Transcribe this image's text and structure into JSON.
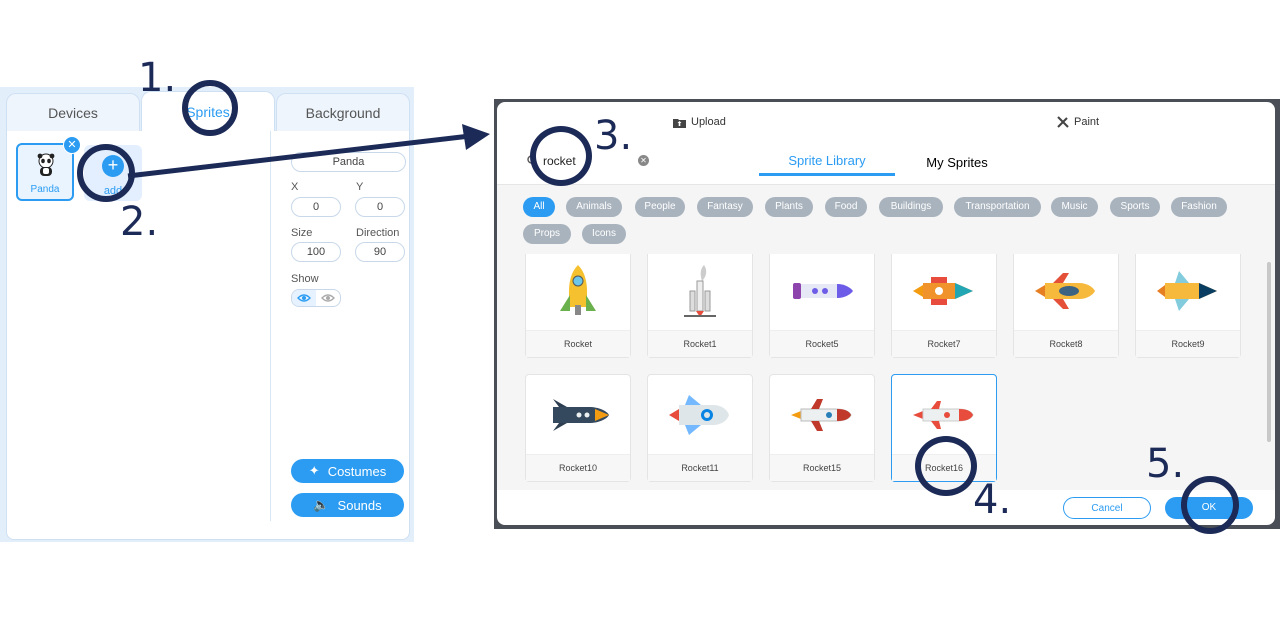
{
  "left_panel": {
    "tabs": [
      {
        "label": "Devices"
      },
      {
        "label": "Sprites",
        "active": true
      },
      {
        "label": "Background"
      }
    ],
    "sprite": {
      "label": "Panda"
    },
    "add_label": "add",
    "props": {
      "x_label": "X",
      "x_value": "0",
      "y_label": "Y",
      "y_value": "0",
      "size_label": "Size",
      "size_value": "100",
      "direction_label": "Direction",
      "direction_value": "90",
      "sprite_name_value": "Panda",
      "show_label": "Show"
    },
    "costumes_label": "Costumes",
    "sounds_label": "Sounds"
  },
  "dialog": {
    "upload_label": "Upload",
    "paint_label": "Paint",
    "search_value": "rocket",
    "tabs": [
      {
        "label": "Sprite Library",
        "active": true
      },
      {
        "label": "My Sprites"
      }
    ],
    "categories": [
      "All",
      "Animals",
      "People",
      "Fantasy",
      "Plants",
      "Food",
      "Buildings",
      "Transportation",
      "Music",
      "Sports",
      "Fashion",
      "Props",
      "Icons"
    ],
    "active_category": "All",
    "sprites": [
      {
        "name": "Rocket"
      },
      {
        "name": "Rocket1"
      },
      {
        "name": "Rocket5"
      },
      {
        "name": "Rocket7"
      },
      {
        "name": "Rocket8"
      },
      {
        "name": "Rocket9"
      },
      {
        "name": "Rocket10"
      },
      {
        "name": "Rocket11"
      },
      {
        "name": "Rocket15"
      },
      {
        "name": "Rocket16",
        "selected": true
      }
    ],
    "cancel_label": "Cancel",
    "ok_label": "OK"
  },
  "annotations": {
    "steps": [
      "1.",
      "2.",
      "3.",
      "4.",
      "5."
    ]
  },
  "colors": {
    "accent": "#2b9cf2",
    "annotation": "#1c2a57",
    "category_pill": "#a9b3bd"
  }
}
